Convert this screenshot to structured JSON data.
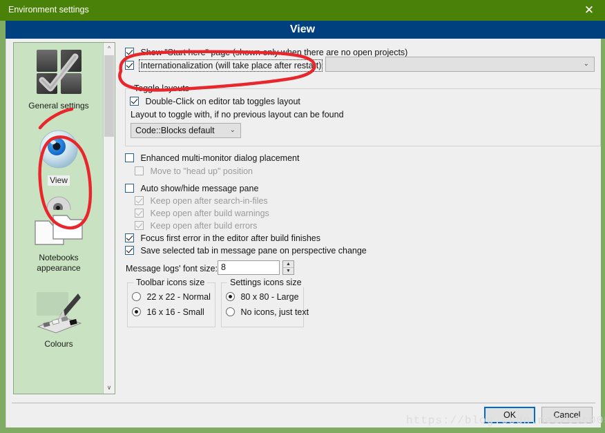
{
  "window": {
    "title": "Environment settings",
    "close_icon": "close-icon",
    "header_title": "View",
    "title_bar_color": "#4a8209",
    "header_color": "#00407f",
    "annotation_color": "#e8272c"
  },
  "sidebar": {
    "items": [
      {
        "label": "General settings",
        "icon": "cubes-check-icon",
        "selected": false
      },
      {
        "label": "View",
        "icon": "eye-icon",
        "selected": true
      },
      {
        "label": "Notebooks appearance",
        "icon": "folders-icon",
        "selected": false
      },
      {
        "label": "Colours",
        "icon": "palette-brush-icon",
        "selected": false
      }
    ],
    "scrollbar": {
      "up_icon": "chevron-up-icon",
      "down_icon": "chevron-down-icon"
    }
  },
  "panel": {
    "show_start_here": {
      "label": "Show \"Start here\" page (shown only when there are no open projects)",
      "checked": true
    },
    "internationalization": {
      "label": "Internationalization (will take place after restart)",
      "checked": true
    },
    "language_combo": {
      "value": "",
      "chevron": "⌄",
      "enabled": false
    },
    "toggle_layouts": {
      "title": "Toggle layouts",
      "double_click": {
        "label": "Double-Click on editor tab toggles layout",
        "checked": true
      },
      "hint": "Layout to toggle with, if no previous layout can be found",
      "layout_combo": {
        "value": "Code::Blocks default",
        "chevron": "⌄"
      }
    },
    "enhanced_multimonitor": {
      "label": "Enhanced multi-monitor dialog placement",
      "checked": false
    },
    "move_head_up": {
      "label": "Move to \"head up\" position",
      "checked": false,
      "disabled": true
    },
    "auto_show_hide": {
      "label": "Auto show/hide message pane",
      "checked": false
    },
    "keep_open_search": {
      "label": "Keep open after search-in-files",
      "checked": true,
      "disabled": true
    },
    "keep_open_warnings": {
      "label": "Keep open after build warnings",
      "checked": true,
      "disabled": true
    },
    "keep_open_errors": {
      "label": "Keep open after build errors",
      "checked": true,
      "disabled": true
    },
    "focus_first_error": {
      "label": "Focus first error in the editor after build finishes",
      "checked": true
    },
    "save_selected_tab": {
      "label": "Save selected tab in message pane on perspective change",
      "checked": true
    },
    "font_size": {
      "label": "Message logs' font size:",
      "value": "8",
      "spin_up": "▲",
      "spin_down": "▼"
    },
    "toolbar_icons_size": {
      "title": "Toolbar icons size",
      "options": [
        {
          "label": "22 x 22 - Normal",
          "checked": false
        },
        {
          "label": "16 x 16 - Small",
          "checked": true
        }
      ]
    },
    "settings_icons_size": {
      "title": "Settings icons size",
      "options": [
        {
          "label": "80 x 80 - Large",
          "checked": true
        },
        {
          "label": "No icons, just text",
          "checked": false
        }
      ]
    }
  },
  "footer": {
    "ok_label": "OK",
    "cancel_label": "Cancel"
  },
  "watermark": "https://blog.csdn.net/c0c0056"
}
